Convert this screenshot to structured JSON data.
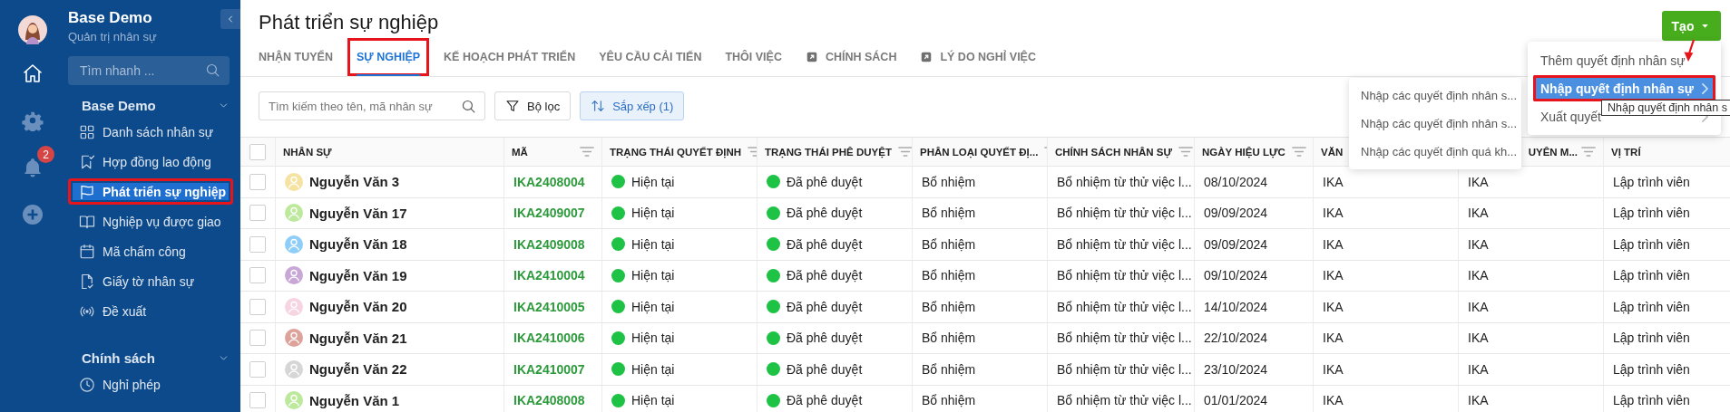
{
  "rail": {
    "notifications": "2"
  },
  "sidebar": {
    "title": "Base Demo",
    "subtitle": "Quản trị nhân sự",
    "search": {
      "placeholder": "Tìm nhanh ..."
    },
    "sections": [
      {
        "title": "Base Demo",
        "expanded": true,
        "items": [
          {
            "label": "Danh sách nhân sự",
            "selected": false,
            "highlighted": false
          },
          {
            "label": "Hợp đồng lao động",
            "selected": false,
            "highlighted": false
          },
          {
            "label": "Phát triển sự nghiệp",
            "selected": true,
            "highlighted": true
          },
          {
            "label": "Nghiệp vụ được giao",
            "selected": false,
            "highlighted": false
          },
          {
            "label": "Mã chấm công",
            "selected": false,
            "highlighted": false
          },
          {
            "label": "Giấy tờ nhân sự",
            "selected": false,
            "highlighted": false
          },
          {
            "label": "Đề xuất",
            "selected": false,
            "highlighted": false
          }
        ]
      },
      {
        "title": "Chính sách",
        "expanded": true,
        "items": [
          {
            "label": "Nghỉ phép",
            "selected": false,
            "highlighted": false
          }
        ]
      }
    ]
  },
  "page": {
    "title": "Phát triển sự nghiệp",
    "tabs": [
      {
        "label": "NHẬN TUYỂN",
        "kind": "tab",
        "selected": false,
        "highlighted": false
      },
      {
        "label": "SỰ NGHIỆP",
        "kind": "tab",
        "selected": true,
        "highlighted": true
      },
      {
        "label": "KẾ HOẠCH PHÁT TRIỂN",
        "kind": "tab",
        "selected": false,
        "highlighted": false
      },
      {
        "label": "YÊU CẦU CẢI TIẾN",
        "kind": "tab",
        "selected": false,
        "highlighted": false
      },
      {
        "label": "THÔI VIỆC",
        "kind": "tab",
        "selected": false,
        "highlighted": false
      },
      {
        "label": "CHÍNH SÁCH",
        "kind": "link",
        "selected": false,
        "highlighted": false
      },
      {
        "label": "LÝ DO NGHỈ VIỆC",
        "kind": "link",
        "selected": false,
        "highlighted": false
      }
    ],
    "create_button": "Tạo",
    "search": {
      "placeholder": "Tìm kiếm theo tên, mã nhân sự"
    },
    "filter_button": "Bộ lọc",
    "sort_button": {
      "label": "Sắp xếp (1)",
      "active": true
    }
  },
  "table": {
    "select_all": {
      "checked": false
    },
    "columns": [
      {
        "label": "NHÂN SỰ",
        "filterable": false
      },
      {
        "label": "MÃ",
        "filterable": true
      },
      {
        "label": "TRẠNG THÁI QUYẾT ĐỊNH",
        "filterable": true
      },
      {
        "label": "TRẠNG THÁI PHÊ DUYỆT",
        "filterable": true
      },
      {
        "label": "PHÂN LOẠI QUYẾT ĐỊ...",
        "filterable": true
      },
      {
        "label": "CHÍNH SÁCH NHÂN SỰ",
        "filterable": true
      },
      {
        "label": "NGÀY HIỆU LỰC",
        "filterable": true
      },
      {
        "label": "VĂN"
      },
      {
        "label": "UYÊN M...",
        "filterable": true
      },
      {
        "label": "VỊ TRÍ",
        "filterable": false
      }
    ],
    "rows": [
      {
        "checked": false,
        "avatar": {
          "color": "#f6e3a1"
        },
        "name": "Nguyễn Văn 3",
        "code": "IKA2408004",
        "decision_status": {
          "text": "Hiện tại",
          "color": "#1ec244"
        },
        "approval_status": {
          "text": "Đã phê duyệt",
          "color": "#1ec244"
        },
        "type": "Bổ nhiệm",
        "policy": "Bổ nhiệm từ thử việc l...",
        "effective_date": "08/10/2024",
        "column_8": "IKA",
        "column_9": "IKA",
        "position": "Lập trình viên"
      },
      {
        "checked": false,
        "avatar": {
          "color": "#bde99c"
        },
        "name": "Nguyễn Văn 17",
        "code": "IKA2409007",
        "decision_status": {
          "text": "Hiện tại",
          "color": "#1ec244"
        },
        "approval_status": {
          "text": "Đã phê duyệt",
          "color": "#1ec244"
        },
        "type": "Bổ nhiệm",
        "policy": "Bổ nhiệm từ thử việc l...",
        "effective_date": "09/09/2024",
        "column_8": "IKA",
        "column_9": "IKA",
        "position": "Lập trình viên"
      },
      {
        "checked": false,
        "avatar": {
          "color": "#8ecdf7"
        },
        "name": "Nguyễn Văn 18",
        "code": "IKA2409008",
        "decision_status": {
          "text": "Hiện tại",
          "color": "#1ec244"
        },
        "approval_status": {
          "text": "Đã phê duyệt",
          "color": "#1ec244"
        },
        "type": "Bổ nhiệm",
        "policy": "Bổ nhiệm từ thử việc l...",
        "effective_date": "09/09/2024",
        "column_8": "IKA",
        "column_9": "IKA",
        "position": "Lập trình viên"
      },
      {
        "checked": false,
        "avatar": {
          "color": "#c8a6d6"
        },
        "name": "Nguyễn Văn 19",
        "code": "IKA2410004",
        "decision_status": {
          "text": "Hiện tại",
          "color": "#1ec244"
        },
        "approval_status": {
          "text": "Đã phê duyệt",
          "color": "#1ec244"
        },
        "type": "Bổ nhiệm",
        "policy": "Bổ nhiệm từ thử việc l...",
        "effective_date": "09/10/2024",
        "column_8": "IKA",
        "column_9": "IKA",
        "position": "Lập trình viên"
      },
      {
        "checked": false,
        "avatar": {
          "color": "#f7d4e1"
        },
        "name": "Nguyễn Văn 20",
        "code": "IKA2410005",
        "decision_status": {
          "text": "Hiện tại",
          "color": "#1ec244"
        },
        "approval_status": {
          "text": "Đã phê duyệt",
          "color": "#1ec244"
        },
        "type": "Bổ nhiệm",
        "policy": "Bổ nhiệm từ thử việc l...",
        "effective_date": "14/10/2024",
        "column_8": "IKA",
        "column_9": "IKA",
        "position": "Lập trình viên"
      },
      {
        "checked": false,
        "avatar": {
          "color": "#dda39b"
        },
        "name": "Nguyễn Văn 21",
        "code": "IKA2410006",
        "decision_status": {
          "text": "Hiện tại",
          "color": "#1ec244"
        },
        "approval_status": {
          "text": "Đã phê duyệt",
          "color": "#1ec244"
        },
        "type": "Bổ nhiệm",
        "policy": "Bổ nhiệm từ thử việc l...",
        "effective_date": "22/10/2024",
        "column_8": "IKA",
        "column_9": "IKA",
        "position": "Lập trình viên"
      },
      {
        "checked": false,
        "avatar": {
          "color": "#d6d6d6"
        },
        "name": "Nguyễn Văn 22",
        "code": "IKA2410007",
        "decision_status": {
          "text": "Hiện tại",
          "color": "#1ec244"
        },
        "approval_status": {
          "text": "Đã phê duyệt",
          "color": "#1ec244"
        },
        "type": "Bổ nhiệm",
        "policy": "Bổ nhiệm từ thử việc l...",
        "effective_date": "23/10/2024",
        "column_8": "IKA",
        "column_9": "IKA",
        "position": "Lập trình viên"
      },
      {
        "checked": false,
        "avatar": {
          "color": "#bde99c"
        },
        "name": "Nguyễn Văn 1",
        "code": "IKA2408008",
        "decision_status": {
          "text": "Hiện tại",
          "color": "#1ec244"
        },
        "approval_status": {
          "text": "Đã phê duyệt",
          "color": "#1ec244"
        },
        "type": "Bổ nhiệm",
        "policy": "Bổ nhiệm từ thử việc l...",
        "effective_date": "01/01/2024",
        "column_8": "IKA",
        "column_9": "IKA",
        "position": "Lập trình viên"
      }
    ]
  },
  "create_menu": {
    "items": [
      {
        "label": "Thêm quyết định nhân sự",
        "submenu": false,
        "selected": false,
        "highlighted": false
      },
      {
        "label": "Nhập quyết định nhân sự",
        "submenu": true,
        "selected": true,
        "highlighted": true
      },
      {
        "label": "Xuất quyết",
        "submenu": true,
        "selected": false,
        "highlighted": false
      }
    ]
  },
  "import_submenu": {
    "items": [
      "Nhập các quyết định nhân s...",
      "Nhập các quyết định nhân s...",
      "Nhập các quyết định quá kh..."
    ]
  },
  "tooltip": "Nhập quyết định nhân s"
}
